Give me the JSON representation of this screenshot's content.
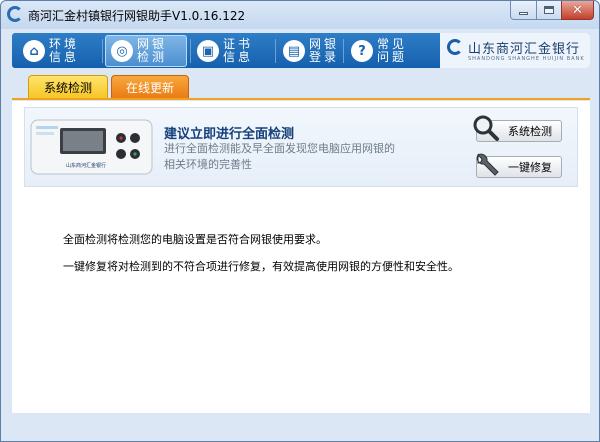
{
  "window": {
    "title": "商河汇金村镇银行网银助手V1.0.16.122",
    "close_glyph": "✕"
  },
  "nav": {
    "items": [
      {
        "label": "环境信息",
        "icon": "home-icon",
        "glyph": "⌂"
      },
      {
        "label": "网银检测",
        "icon": "stethoscope-icon",
        "glyph": "◎"
      },
      {
        "label": "证书信息",
        "icon": "certificate-icon",
        "glyph": "▣"
      },
      {
        "label": "网银登录",
        "icon": "computer-icon",
        "glyph": "▤"
      },
      {
        "label": "常见问题",
        "icon": "question-icon",
        "glyph": "?"
      }
    ],
    "active_index": 1
  },
  "logo": {
    "name": "山东商河汇金银行",
    "subtitle": "SHANDONG SHANGHE HUIJIN BANK"
  },
  "tabs": {
    "check": "系统检测",
    "update": "在线更新"
  },
  "banner": {
    "title": "建议立即进行全面检测",
    "desc": "进行全面检测能及早全面发现您电脑应用网银的相关环境的完善性",
    "device_label": "山东商河汇金银行"
  },
  "buttons": {
    "check": "系统检测",
    "repair": "一键修复"
  },
  "info": {
    "line1": "全面检测将检测您的电脑设置是否符合网银使用要求。",
    "line2": "一键修复将对检测到的不符合项进行修复，有效提高使用网银的方便性和安全性。"
  },
  "colors": {
    "nav_blue": "#1a64b0",
    "tab_yellow": "#f6c627",
    "tab_orange": "#ea7c14",
    "title_blue": "#163f7a"
  }
}
